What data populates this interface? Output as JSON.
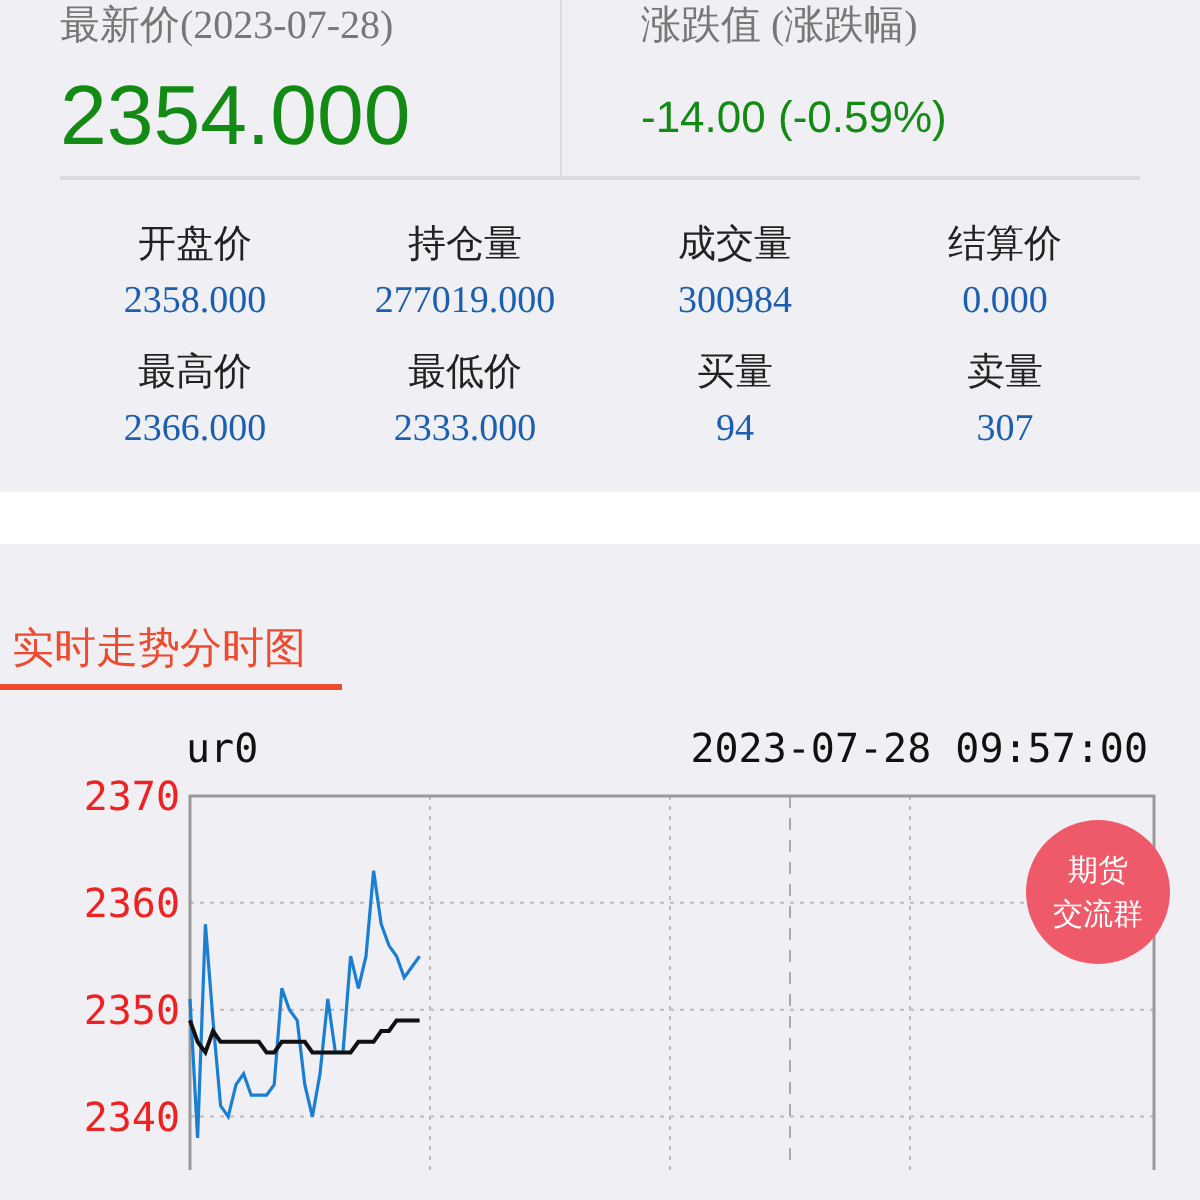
{
  "quote": {
    "latest_label": "最新价(2023-07-28)",
    "latest_value": "2354.000",
    "change_label": "涨跌值 (涨跌幅)",
    "change_value": "-14.00 (-0.59%)"
  },
  "stats": [
    {
      "label": "开盘价",
      "value": "2358.000"
    },
    {
      "label": "持仓量",
      "value": "277019.000"
    },
    {
      "label": "成交量",
      "value": "300984"
    },
    {
      "label": "结算价",
      "value": "0.000"
    },
    {
      "label": "最高价",
      "value": "2366.000"
    },
    {
      "label": "最低价",
      "value": "2333.000"
    },
    {
      "label": "买量",
      "value": "94"
    },
    {
      "label": "卖量",
      "value": "307"
    }
  ],
  "section": {
    "title": "实时走势分时图"
  },
  "chart": {
    "symbol": "ur0",
    "timestamp": "2023-07-28 09:57:00",
    "chart_data": {
      "type": "line",
      "ylim": [
        2335,
        2370
      ],
      "yticks": [
        2340,
        2350,
        2360,
        2370
      ],
      "grid": true,
      "categories": [
        null,
        null,
        null,
        null,
        null,
        null,
        null,
        null,
        null,
        null,
        null,
        null,
        null,
        null,
        null,
        null,
        null,
        null,
        null,
        null,
        null,
        null,
        null,
        null,
        null,
        null,
        null,
        null,
        null,
        null,
        null,
        null,
        null,
        null,
        null,
        null,
        null,
        null,
        null,
        null,
        null,
        null,
        null,
        null,
        null,
        null,
        null,
        null,
        null,
        null,
        null,
        null,
        null,
        null,
        null,
        null,
        null,
        null,
        null,
        null,
        null,
        null,
        null,
        null,
        null,
        null,
        null,
        null,
        null,
        null,
        null,
        null,
        null,
        null,
        null,
        null,
        null,
        null,
        null,
        null,
        null,
        null,
        null,
        null,
        null,
        null,
        null,
        null,
        null,
        null,
        null,
        null,
        null,
        null,
        null,
        null,
        null,
        null,
        null,
        null,
        null,
        null,
        null,
        null,
        null,
        null,
        null,
        null,
        null,
        null,
        null,
        null,
        null,
        null,
        null,
        null,
        null,
        null,
        null,
        null,
        null,
        null,
        null,
        null,
        null,
        null,
        null
      ],
      "series": [
        {
          "color": "#1a7fd0",
          "values": [
            2351,
            2338,
            2358,
            2349,
            2341,
            2340,
            2343,
            2344,
            2342,
            2342,
            2342,
            2343,
            2352,
            2350,
            2349,
            2343,
            2340,
            2344,
            2351,
            2346,
            2346,
            2355,
            2352,
            2355,
            2363,
            2358,
            2356,
            2355,
            2353,
            2354,
            2355,
            null,
            null,
            null,
            null,
            null,
            null,
            null,
            null,
            null,
            null,
            null,
            null,
            null,
            null,
            null,
            null,
            null,
            null,
            null,
            null,
            null,
            null,
            null,
            null,
            null,
            null,
            null,
            null,
            null,
            null,
            null,
            null,
            null,
            null,
            null,
            null,
            null,
            null,
            null,
            null,
            null,
            null,
            null,
            null,
            null,
            null,
            null,
            null,
            null,
            null,
            null,
            null,
            null,
            null,
            null,
            null,
            null,
            null,
            null,
            null,
            null,
            null,
            null,
            null,
            null,
            null,
            null,
            null,
            null,
            null,
            null,
            null,
            null,
            null,
            null,
            null,
            null,
            null,
            null,
            null,
            null,
            null,
            null,
            null,
            null,
            null,
            null,
            null,
            null,
            null,
            null,
            null,
            null,
            null,
            null,
            null
          ]
        },
        {
          "color": "#111111",
          "values": [
            2349,
            2347,
            2346,
            2348,
            2347,
            2347,
            2347,
            2347,
            2347,
            2347,
            2346,
            2346,
            2347,
            2347,
            2347,
            2347,
            2346,
            2346,
            2346,
            2346,
            2346,
            2346,
            2347,
            2347,
            2347,
            2348,
            2348,
            2349,
            2349,
            2349,
            2349,
            null,
            null,
            null,
            null,
            null,
            null,
            null,
            null,
            null,
            null,
            null,
            null,
            null,
            null,
            null,
            null,
            null,
            null,
            null,
            null,
            null,
            null,
            null,
            null,
            null,
            null,
            null,
            null,
            null,
            null,
            null,
            null,
            null,
            null,
            null,
            null,
            null,
            null,
            null,
            null,
            null,
            null,
            null,
            null,
            null,
            null,
            null,
            null,
            null,
            null,
            null,
            null,
            null,
            null,
            null,
            null,
            null,
            null,
            null,
            null,
            null,
            null,
            null,
            null,
            null,
            null,
            null,
            null,
            null,
            null,
            null,
            null,
            null,
            null,
            null,
            null,
            null,
            null,
            null,
            null,
            null,
            null,
            null,
            null,
            null,
            null,
            null,
            null,
            null,
            null,
            null,
            null,
            null,
            null,
            null,
            null
          ]
        }
      ]
    }
  },
  "float_button": {
    "line_1": "期货",
    "line_2": "交流群"
  }
}
